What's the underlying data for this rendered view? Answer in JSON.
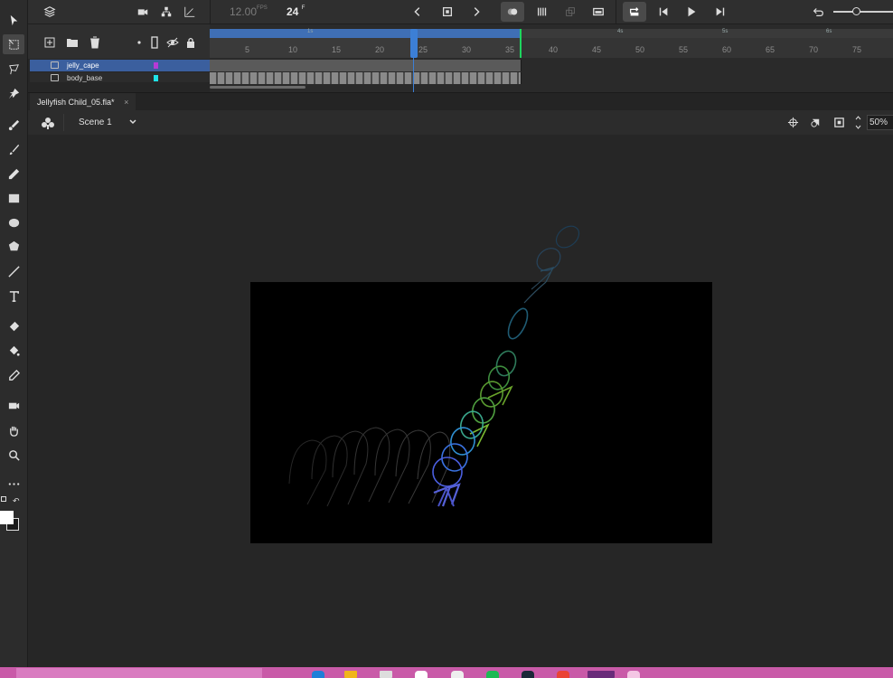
{
  "playback": {
    "fps_value": "12.00",
    "fps_unit": "FPS",
    "frame_value": "24",
    "frame_unit": "F"
  },
  "layers": [
    {
      "name": "jelly_cape",
      "color": "#b63ad6",
      "selected": true
    },
    {
      "name": "body_base",
      "color": "#1fe3e8",
      "selected": false
    }
  ],
  "timeline": {
    "frame_numbers": [
      "5",
      "10",
      "15",
      "20",
      "25",
      "30",
      "35",
      "40",
      "45",
      "50",
      "55",
      "60",
      "65",
      "70",
      "75"
    ],
    "seconds_markers": [
      "1s",
      "4s",
      "5s",
      "6s"
    ],
    "current_frame": 24,
    "span_end_frame": 36
  },
  "document": {
    "tab_label": "Jellyfish Child_05.fla*",
    "close_glyph": "×"
  },
  "scene": {
    "label": "Scene 1",
    "zoom": "50%"
  },
  "icons": {
    "tools": [
      "selection-arrow-icon",
      "free-transform-icon",
      "lasso-icon",
      "pin-icon",
      "paint-brush-icon",
      "brush-icon",
      "pencil-icon",
      "rectangle-icon",
      "oval-icon",
      "polystar-icon",
      "line-icon",
      "text-icon",
      "eraser-icon",
      "paint-bucket-icon",
      "eyedropper-icon",
      "camera-icon",
      "hand-icon",
      "zoom-icon",
      "more-icon"
    ]
  },
  "colors": {
    "selection_blue": "#3b5f9e",
    "playhead_blue": "#3c7fd6",
    "end_marker_green": "#1ed65f",
    "taskbar_pink": "#c95aa8"
  }
}
